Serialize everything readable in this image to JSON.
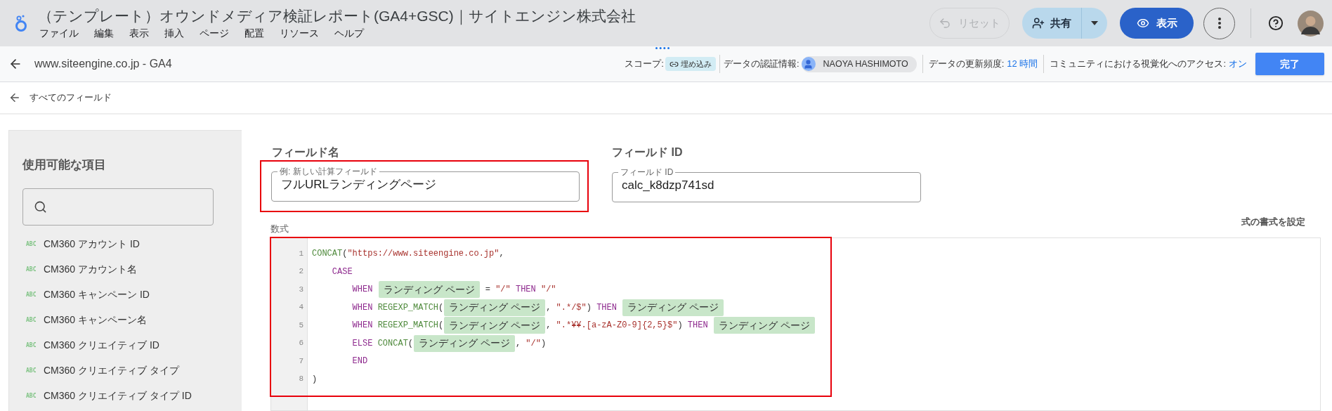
{
  "header": {
    "title": "（テンプレート）オウンドメディア検証レポート(GA4+GSC)｜サイトエンジン株式会社",
    "menu": [
      "ファイル",
      "編集",
      "表示",
      "挿入",
      "ページ",
      "配置",
      "リソース",
      "ヘルプ"
    ],
    "reset_button": {
      "label": "リセット",
      "disabled": true
    },
    "share_button": {
      "label": "共有"
    },
    "view_button": {
      "label": "表示"
    }
  },
  "data_source_bar": {
    "name": "www.siteengine.co.jp - GA4",
    "scope_label": "スコープ:",
    "scope_chip": "埋め込み",
    "credentials_label": "データの認証情報:",
    "credentials_user": "NAOYA HASHIMOTO",
    "freshness_label": "データの更新頻度:",
    "freshness_value": "12 時間",
    "community_label": "コミュニティにおける視覚化へのアクセス:",
    "community_value": "オン",
    "done_button": "完了"
  },
  "breadcrumb": "すべてのフィールド",
  "sidebar": {
    "title": "使用可能な項目",
    "items": [
      {
        "type": "ABC",
        "label": "CM360 アカウント ID"
      },
      {
        "type": "ABC",
        "label": "CM360 アカウント名"
      },
      {
        "type": "ABC",
        "label": "CM360 キャンペーン ID"
      },
      {
        "type": "ABC",
        "label": "CM360 キャンペーン名"
      },
      {
        "type": "ABC",
        "label": "CM360 クリエイティブ ID"
      },
      {
        "type": "ABC",
        "label": "CM360 クリエイティブ タイプ"
      },
      {
        "type": "ABC",
        "label": "CM360 クリエイティブ タイプ ID"
      }
    ]
  },
  "field_name": {
    "heading": "フィールド名",
    "label": "例: 新しい計算フィールド",
    "value": "フルURLランディングページ"
  },
  "field_id": {
    "heading": "フィールド ID",
    "label": "フィールド ID",
    "value": "calc_k8dzp741sd"
  },
  "formula": {
    "label": "数式",
    "format_link": "式の書式を設定",
    "lines": [
      {
        "number": "1",
        "tokens": [
          {
            "kind": "function",
            "text": "CONCAT"
          },
          {
            "kind": "plain",
            "text": "("
          },
          {
            "kind": "string",
            "text": "\"https://www.siteengine.co.jp\""
          },
          {
            "kind": "plain",
            "text": ","
          }
        ]
      },
      {
        "number": "2",
        "tokens": [
          {
            "kind": "keyword",
            "text": "    CASE"
          }
        ]
      },
      {
        "number": "3",
        "tokens": [
          {
            "kind": "keyword",
            "text": "        WHEN "
          },
          {
            "kind": "field",
            "text": "ランディング ページ"
          },
          {
            "kind": "plain",
            "text": " = "
          },
          {
            "kind": "string",
            "text": "\"/\""
          },
          {
            "kind": "keyword",
            "text": " THEN "
          },
          {
            "kind": "string",
            "text": "\"/\""
          }
        ]
      },
      {
        "number": "4",
        "tokens": [
          {
            "kind": "keyword",
            "text": "        WHEN "
          },
          {
            "kind": "function",
            "text": "REGEXP_MATCH"
          },
          {
            "kind": "plain",
            "text": "("
          },
          {
            "kind": "field",
            "text": "ランディング ページ"
          },
          {
            "kind": "plain",
            "text": ", "
          },
          {
            "kind": "string",
            "text": "\".*/$\""
          },
          {
            "kind": "plain",
            "text": ") "
          },
          {
            "kind": "keyword",
            "text": "THEN "
          },
          {
            "kind": "field",
            "text": "ランディング ページ"
          }
        ]
      },
      {
        "number": "5",
        "tokens": [
          {
            "kind": "keyword",
            "text": "        WHEN "
          },
          {
            "kind": "function",
            "text": "REGEXP_MATCH"
          },
          {
            "kind": "plain",
            "text": "("
          },
          {
            "kind": "field",
            "text": "ランディング ページ"
          },
          {
            "kind": "plain",
            "text": ", "
          },
          {
            "kind": "string",
            "text": "\".*¥¥.[a-zA-Z0-9]{2,5}$\""
          },
          {
            "kind": "plain",
            "text": ") "
          },
          {
            "kind": "keyword",
            "text": "THEN "
          },
          {
            "kind": "field",
            "text": "ランディング ページ"
          }
        ]
      },
      {
        "number": "6",
        "tokens": [
          {
            "kind": "keyword",
            "text": "        ELSE "
          },
          {
            "kind": "function",
            "text": "CONCAT"
          },
          {
            "kind": "plain",
            "text": "("
          },
          {
            "kind": "field",
            "text": "ランディング ページ"
          },
          {
            "kind": "plain",
            "text": ", "
          },
          {
            "kind": "string",
            "text": "\"/\""
          },
          {
            "kind": "plain",
            "text": ")"
          }
        ]
      },
      {
        "number": "7",
        "tokens": [
          {
            "kind": "keyword",
            "text": "        END"
          }
        ]
      },
      {
        "number": "8",
        "tokens": [
          {
            "kind": "plain",
            "text": ")"
          }
        ]
      }
    ]
  }
}
